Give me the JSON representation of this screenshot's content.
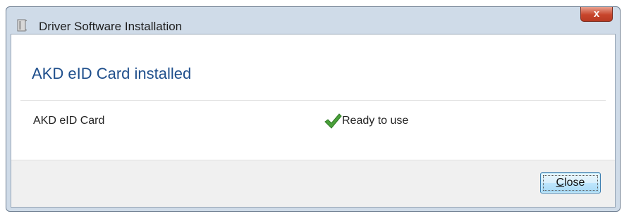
{
  "window": {
    "title": "Driver Software Installation",
    "close_glyph": "x"
  },
  "heading": "AKD eID Card installed",
  "devices": [
    {
      "name": "AKD eID Card",
      "status": "Ready to use",
      "status_icon": "check-icon",
      "status_color": "#4aa03a"
    }
  ],
  "footer": {
    "close_button": {
      "label_prefix": "",
      "label_accel": "C",
      "label_rest": "lose"
    }
  },
  "colors": {
    "heading": "#1f4f8c",
    "close_button_red": "#c7452c",
    "button_blue": "#a7d9f5"
  }
}
